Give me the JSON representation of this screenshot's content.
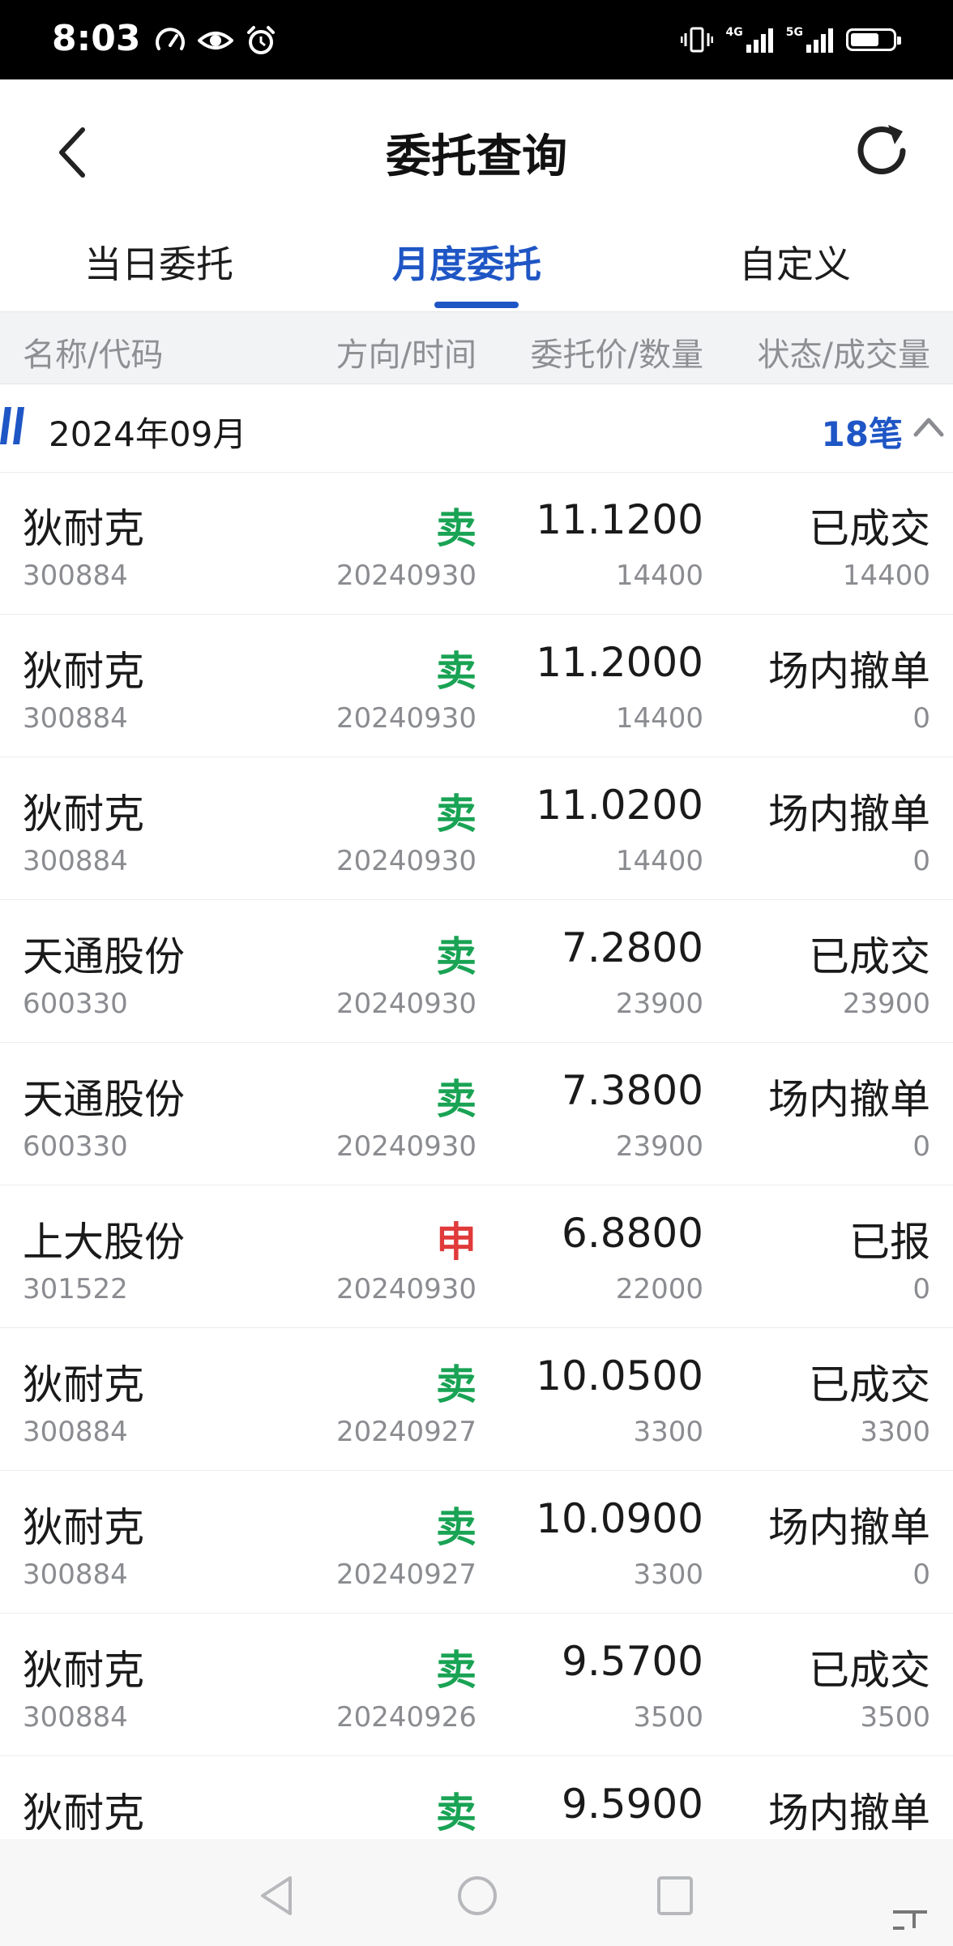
{
  "status_bar": {
    "time": "8:03",
    "net1": "4G",
    "net2": "5G"
  },
  "header": {
    "title": "委托查询"
  },
  "tabs": [
    {
      "label": "当日委托"
    },
    {
      "label": "月度委托"
    },
    {
      "label": "自定义"
    }
  ],
  "active_tab": "月度委托",
  "columns": {
    "name": "名称/代码",
    "direction": "方向/时间",
    "price": "委托价/数量",
    "status": "状态/成交量"
  },
  "group": {
    "label": "2024年09月",
    "count": "18笔"
  },
  "colors": {
    "accent": "#1f56c5",
    "sell": "#19a354",
    "apply": "#e03a3a"
  },
  "rows": [
    {
      "name": "狄耐克",
      "code": "300884",
      "dir": "卖",
      "date": "20240930",
      "price": "11.1200",
      "qty": "14400",
      "status": "已成交",
      "filled": "14400"
    },
    {
      "name": "狄耐克",
      "code": "300884",
      "dir": "卖",
      "date": "20240930",
      "price": "11.2000",
      "qty": "14400",
      "status": "场内撤单",
      "filled": "0"
    },
    {
      "name": "狄耐克",
      "code": "300884",
      "dir": "卖",
      "date": "20240930",
      "price": "11.0200",
      "qty": "14400",
      "status": "场内撤单",
      "filled": "0"
    },
    {
      "name": "天通股份",
      "code": "600330",
      "dir": "卖",
      "date": "20240930",
      "price": "7.2800",
      "qty": "23900",
      "status": "已成交",
      "filled": "23900"
    },
    {
      "name": "天通股份",
      "code": "600330",
      "dir": "卖",
      "date": "20240930",
      "price": "7.3800",
      "qty": "23900",
      "status": "场内撤单",
      "filled": "0"
    },
    {
      "name": "上大股份",
      "code": "301522",
      "dir": "申",
      "date": "20240930",
      "price": "6.8800",
      "qty": "22000",
      "status": "已报",
      "filled": "0"
    },
    {
      "name": "狄耐克",
      "code": "300884",
      "dir": "卖",
      "date": "20240927",
      "price": "10.0500",
      "qty": "3300",
      "status": "已成交",
      "filled": "3300"
    },
    {
      "name": "狄耐克",
      "code": "300884",
      "dir": "卖",
      "date": "20240927",
      "price": "10.0900",
      "qty": "3300",
      "status": "场内撤单",
      "filled": "0"
    },
    {
      "name": "狄耐克",
      "code": "300884",
      "dir": "卖",
      "date": "20240926",
      "price": "9.5700",
      "qty": "3500",
      "status": "已成交",
      "filled": "3500"
    },
    {
      "name": "狄耐克",
      "code": "300884",
      "dir": "卖",
      "date": "",
      "price": "9.5900",
      "qty": "",
      "status": "场内撤单",
      "filled": ""
    }
  ]
}
